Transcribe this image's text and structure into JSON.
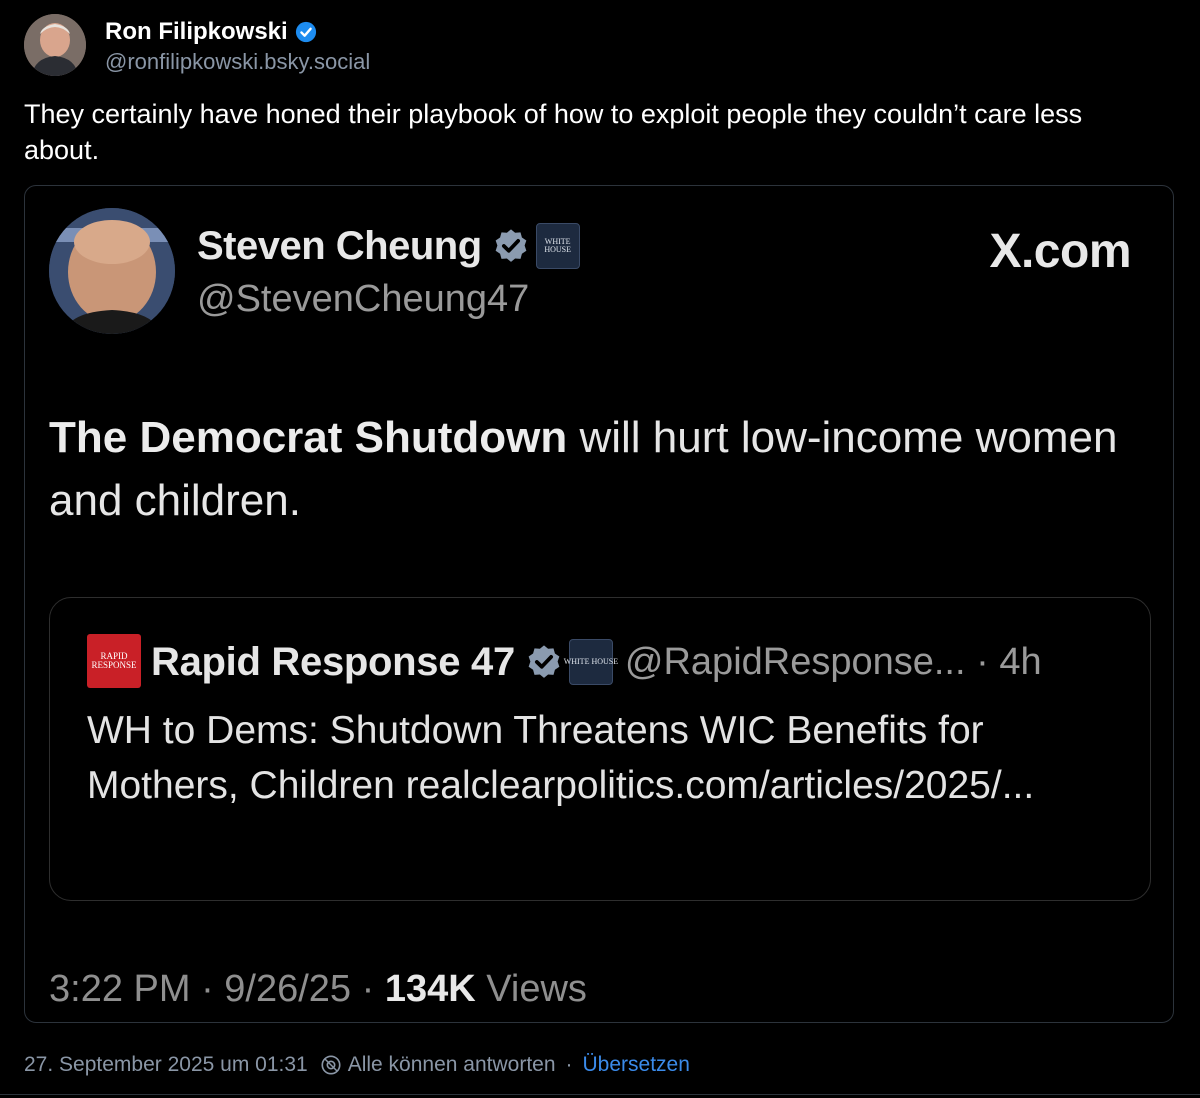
{
  "post": {
    "author_name": "Ron Filipkowski",
    "author_handle": "@ronfilipkowski.bsky.social",
    "text": "They certainly have honed their playbook of how to exploit people they couldn’t care less about."
  },
  "embedded_screenshot": {
    "name": "Steven Cheung",
    "handle": "@StevenCheung47",
    "white_house_logo_text": "WHITE HOUSE",
    "source_label": "X.com",
    "text_bold": "The Democrat Shutdown",
    "text_rest": " will hurt low-income women and children.",
    "quoted": {
      "logo_text": "RAPID RESPONSE",
      "name": "Rapid Response 47",
      "handle_time": "@RapidResponse... · 4h",
      "text": "WH to Dems: Shutdown Threatens WIC Benefits for Mothers, Children realclearpolitics.com/articles/2025/..."
    },
    "meta_time": "3:22 PM · 9/26/25 · ",
    "meta_views_count": "134K",
    "meta_views_label": " Views"
  },
  "footer": {
    "timestamp": "27. September 2025 um 01:31",
    "reply_setting": "Alle können antworten",
    "separator": "·",
    "translate": "Übersetzen"
  },
  "colors": {
    "background": "#000000",
    "verified_blue": "#1d8cf0",
    "link_blue": "#3b8bea",
    "muted_text": "#8a96a6"
  },
  "icons": [
    "verified-badge-icon",
    "white-house-logo",
    "rapid-response-logo",
    "reply-settings-icon"
  ]
}
